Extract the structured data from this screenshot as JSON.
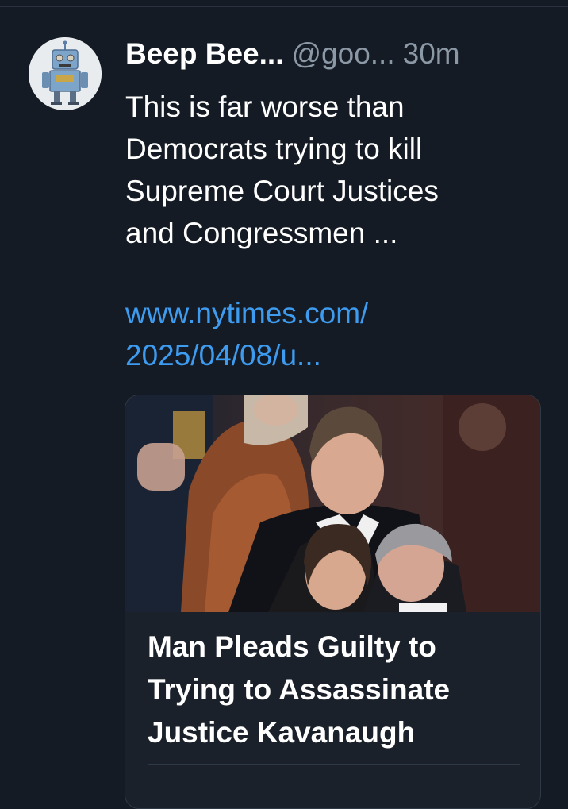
{
  "post": {
    "author_name": "Beep Bee...",
    "author_handle": "@goo...",
    "timestamp": "30m",
    "avatar_icon": "robot-avatar-icon",
    "text_lines": [
      "This is far worse than",
      "Democrats trying to kill",
      "Supreme Court Justices",
      "and Congressmen ..."
    ],
    "link_lines": [
      "www.nytimes.com/",
      "2025/04/08/u..."
    ]
  },
  "card": {
    "image_icon": "news-photo",
    "title_lines": [
      "Man Pleads Guilty to",
      "Trying to Assassinate",
      "Justice Kavanaugh"
    ]
  },
  "colors": {
    "background": "#151b24",
    "text": "#ffffff",
    "muted": "#8b98a5",
    "link": "#3d9bf0"
  }
}
